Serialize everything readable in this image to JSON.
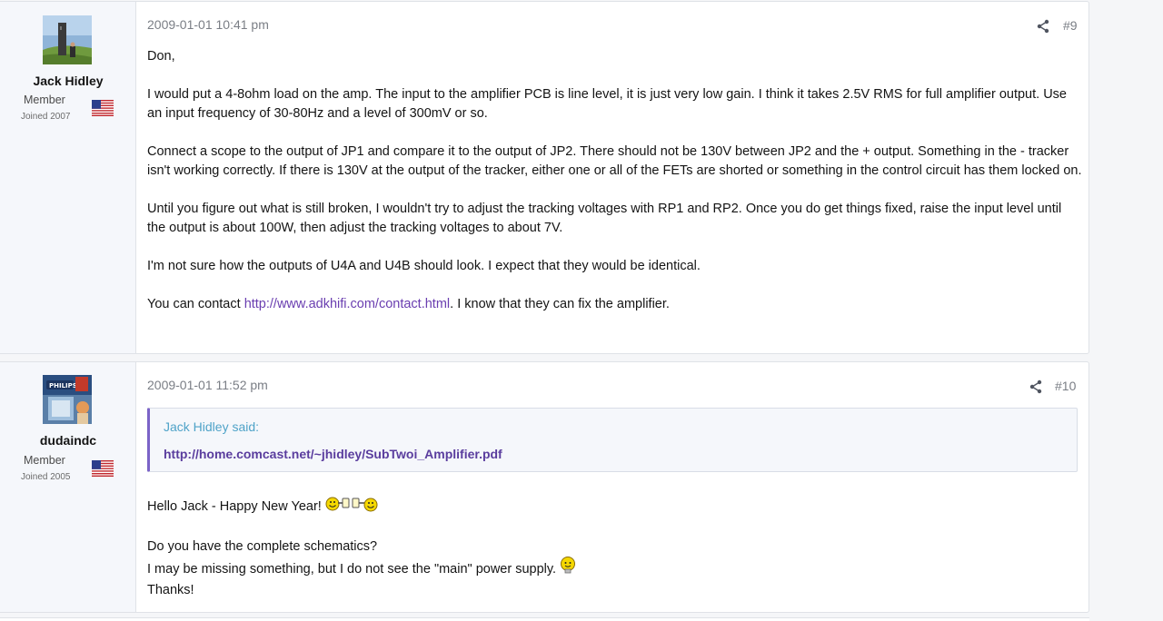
{
  "posts": [
    {
      "username": "Jack Hidley",
      "role": "Member",
      "joined": "Joined 2007",
      "date": "2009-01-01 10:41 pm",
      "number": "#9",
      "paragraphs": {
        "p1": "Don,",
        "p2": "I would put a 4-8ohm load on the amp. The input to the amplifier PCB is line level, it is just very low gain. I think it takes 2.5V RMS for full amplifier output. Use an input frequency of 30-80Hz and a level of 300mV or so.",
        "p3": "Connect a scope to the output of JP1 and compare it to the output of JP2. There should not be 130V between JP2 and the + output. Something in the - tracker isn't working correctly. If there is 130V at the output of the tracker, either one or all of the FETs are shorted or something in the control circuit has them locked on.",
        "p4": "Until you figure out what is still broken, I wouldn't try to adjust the tracking voltages with RP1 and RP2. Once you do get things fixed, raise the input level until the output is about 100W, then adjust the tracking voltages to about 7V.",
        "p5": "I'm not sure how the outputs of U4A and U4B should look. I expect that they would be identical.",
        "p6_prefix": "You can contact ",
        "p6_link": "http://www.adkhifi.com/contact.html",
        "p6_suffix": ". I know that they can fix the amplifier."
      }
    },
    {
      "username": "dudaindc",
      "role": "Member",
      "joined": "Joined 2005",
      "date": "2009-01-01 11:52 pm",
      "number": "#10",
      "quote_author": "Jack Hidley said:",
      "quote_link": "http://home.comcast.net/~jhidley/SubTwoi_Amplifier.pdf",
      "paragraphs": {
        "p1": "Hello Jack - Happy New Year!",
        "p2a": "Do you have the complete schematics?",
        "p2b": "I may be missing something, but I do not see the \"main\" power supply.",
        "p2c": "Thanks!"
      }
    }
  ],
  "icons": {
    "share": "share-icon",
    "flag": "us-flag-icon",
    "smiley_cheers": "cheers-smiley-icon",
    "smiley_idea": "idea-smiley-icon"
  },
  "colors": {
    "link": "#6a3eb0",
    "quote_author": "#4fa3c8",
    "quote_border": "#7b63c7",
    "muted": "#7a7e85",
    "sidebar_bg": "#f5f7fb"
  }
}
